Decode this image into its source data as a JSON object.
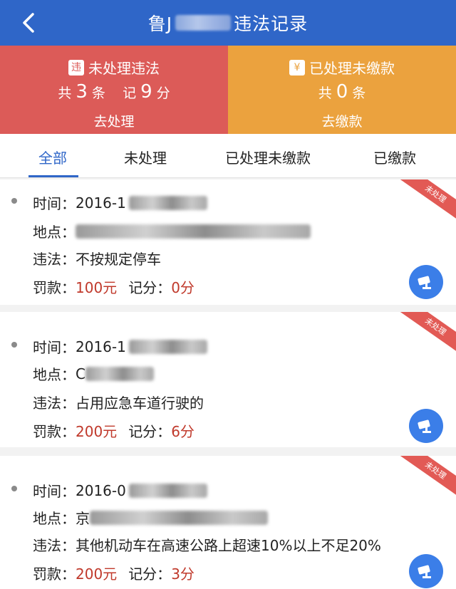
{
  "header": {
    "title_prefix": "鲁J",
    "title_suffix": "违法记录"
  },
  "summary": {
    "unprocessed": {
      "badge": "违",
      "title": "未处理违法",
      "count_prefix": "共",
      "count": "3",
      "count_unit": "条",
      "points_prefix": "记",
      "points": "9",
      "points_unit": "分",
      "action": "去处理"
    },
    "unpaid": {
      "badge": "¥",
      "title": "已处理未缴款",
      "count_prefix": "共",
      "count": "0",
      "count_unit": "条",
      "action": "去缴款"
    }
  },
  "tabs": [
    {
      "label": "全部"
    },
    {
      "label": "未处理"
    },
    {
      "label": "已处理未缴款"
    },
    {
      "label": "已缴款"
    }
  ],
  "labels": {
    "time": "时间：",
    "location": "地点：",
    "violation": "违法：",
    "fine": "罚款：",
    "points": "记分："
  },
  "records": [
    {
      "status": "未处理",
      "time": "2016-1",
      "location": "",
      "violation": "不按规定停车",
      "fine": "100元",
      "points": "0分"
    },
    {
      "status": "未处理",
      "time": "2016-1",
      "location": "C",
      "violation": "占用应急车道行驶的",
      "fine": "200元",
      "points": "6分"
    },
    {
      "status": "未处理",
      "time": "2016-0",
      "location": "京",
      "violation": "其他机动车在高速公路上超速10%以上不足20%",
      "fine": "200元",
      "points": "3分"
    }
  ],
  "colors": {
    "primary": "#2f66c8",
    "unprocessed_bg": "#dc5b58",
    "unpaid_bg": "#eba23e",
    "fine_text": "#c0392b",
    "ribbon": "#e25a55"
  }
}
